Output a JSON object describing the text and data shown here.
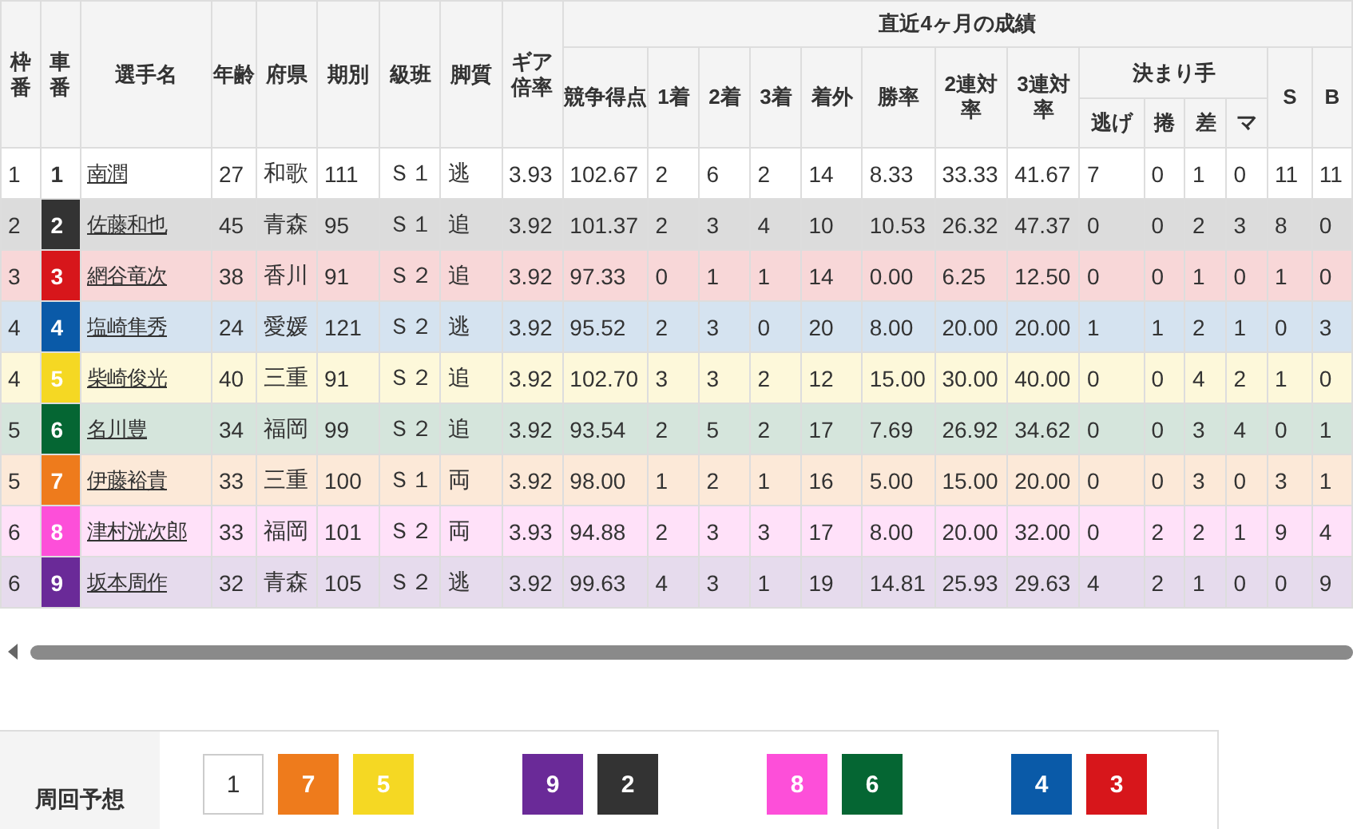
{
  "table": {
    "group_header": "直近4ヶ月の成績",
    "kimarite_header": "決まり手",
    "columns": [
      "枠番",
      "車番",
      "選手名",
      "年齢",
      "府県",
      "期別",
      "級班",
      "脚質",
      "ギア倍率",
      "競争得点",
      "1着",
      "2着",
      "3着",
      "着外",
      "勝率",
      "2連対率",
      "3連対率",
      "逃げ",
      "捲",
      "差",
      "マ",
      "S",
      "B"
    ],
    "rows": [
      {
        "color": "#ffffff",
        "cells": [
          "1",
          "1",
          "南潤",
          "27",
          "和歌",
          "111",
          "Ｓ１",
          "逃",
          "3.93",
          "102.67",
          "2",
          "6",
          "2",
          "14",
          "8.33",
          "33.33",
          "41.67",
          "7",
          "0",
          "1",
          "0",
          "11",
          "11"
        ]
      },
      {
        "color": "#333333",
        "cells": [
          "2",
          "2",
          "佐藤和也",
          "45",
          "青森",
          "95",
          "Ｓ１",
          "追",
          "3.92",
          "101.37",
          "2",
          "3",
          "4",
          "10",
          "10.53",
          "26.32",
          "47.37",
          "0",
          "0",
          "2",
          "3",
          "8",
          "0"
        ]
      },
      {
        "color": "#d7161b",
        "cells": [
          "3",
          "3",
          "網谷竜次",
          "38",
          "香川",
          "91",
          "Ｓ２",
          "追",
          "3.92",
          "97.33",
          "0",
          "1",
          "1",
          "14",
          "0.00",
          "6.25",
          "12.50",
          "0",
          "0",
          "1",
          "0",
          "1",
          "0"
        ]
      },
      {
        "color": "#0a5aa8",
        "cells": [
          "4",
          "4",
          "塩崎隼秀",
          "24",
          "愛媛",
          "121",
          "Ｓ２",
          "逃",
          "3.92",
          "95.52",
          "2",
          "3",
          "0",
          "20",
          "8.00",
          "20.00",
          "20.00",
          "1",
          "1",
          "2",
          "1",
          "0",
          "3"
        ]
      },
      {
        "color": "#f5d823",
        "cells": [
          "4",
          "5",
          "柴崎俊光",
          "40",
          "三重",
          "91",
          "Ｓ２",
          "追",
          "3.92",
          "102.70",
          "3",
          "3",
          "2",
          "12",
          "15.00",
          "30.00",
          "40.00",
          "0",
          "0",
          "4",
          "2",
          "1",
          "0"
        ]
      },
      {
        "color": "#056633",
        "cells": [
          "5",
          "6",
          "名川豊",
          "34",
          "福岡",
          "99",
          "Ｓ２",
          "追",
          "3.92",
          "93.54",
          "2",
          "5",
          "2",
          "17",
          "7.69",
          "26.92",
          "34.62",
          "0",
          "0",
          "3",
          "4",
          "0",
          "1"
        ]
      },
      {
        "color": "#ee7b1c",
        "cells": [
          "5",
          "7",
          "伊藤裕貴",
          "33",
          "三重",
          "100",
          "Ｓ１",
          "両",
          "3.92",
          "98.00",
          "1",
          "2",
          "1",
          "16",
          "5.00",
          "15.00",
          "20.00",
          "0",
          "0",
          "3",
          "0",
          "3",
          "1"
        ]
      },
      {
        "color": "#fd4fd9",
        "cells": [
          "6",
          "8",
          "津村洸次郎",
          "33",
          "福岡",
          "101",
          "Ｓ２",
          "両",
          "3.93",
          "94.88",
          "2",
          "3",
          "3",
          "17",
          "8.00",
          "20.00",
          "32.00",
          "0",
          "2",
          "2",
          "1",
          "9",
          "4"
        ]
      },
      {
        "color": "#6a2a98",
        "cells": [
          "6",
          "9",
          "坂本周作",
          "32",
          "青森",
          "105",
          "Ｓ２",
          "逃",
          "3.92",
          "99.63",
          "4",
          "3",
          "1",
          "19",
          "14.81",
          "25.93",
          "29.63",
          "4",
          "2",
          "1",
          "0",
          "0",
          "9"
        ]
      }
    ]
  },
  "prediction": {
    "label": "周回予想",
    "groups": [
      [
        {
          "car": "1",
          "color": "#ffffff"
        },
        {
          "car": "7",
          "color": "#ee7b1c"
        },
        {
          "car": "5",
          "color": "#f5d823"
        }
      ],
      [
        {
          "car": "9",
          "color": "#6a2a98"
        },
        {
          "car": "2",
          "color": "#333333"
        }
      ],
      [
        {
          "car": "8",
          "color": "#fd4fd9"
        },
        {
          "car": "6",
          "color": "#056633"
        }
      ],
      [
        {
          "car": "4",
          "color": "#0a5aa8"
        },
        {
          "car": "3",
          "color": "#d7161b"
        }
      ]
    ]
  }
}
